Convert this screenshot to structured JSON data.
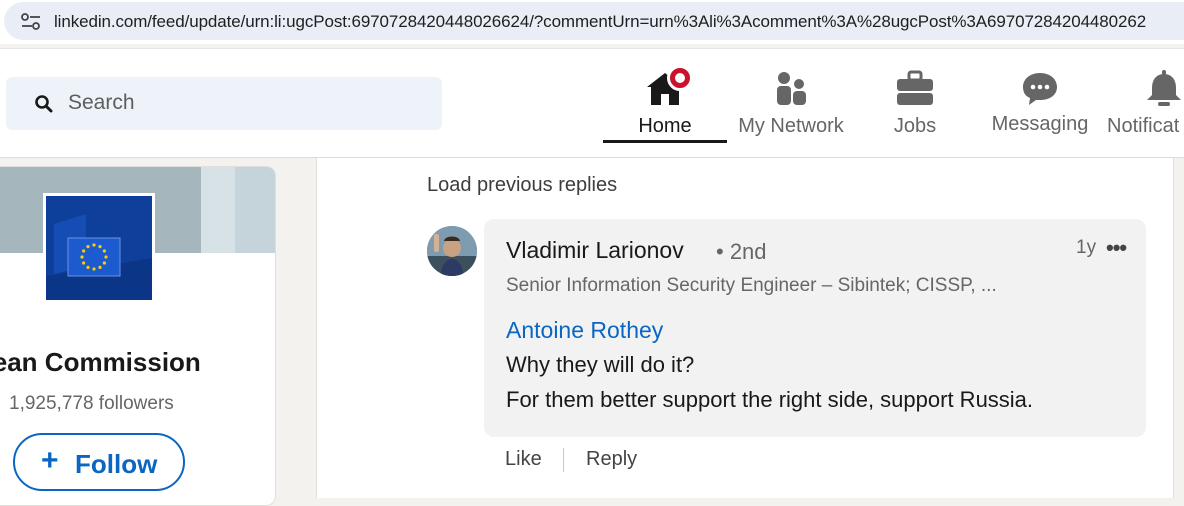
{
  "browser": {
    "url": "linkedin.com/feed/update/urn:li:ugcPost:6970728420448026624/?commentUrn=urn%3Ali%3Acomment%3A%28ugcPost%3A69707284204480262"
  },
  "header": {
    "search_placeholder": "Search",
    "nav": [
      {
        "label": "Home",
        "icon": "home-icon",
        "active": true
      },
      {
        "label": "My Network",
        "icon": "network-icon"
      },
      {
        "label": "Jobs",
        "icon": "briefcase-icon"
      },
      {
        "label": "Messaging",
        "icon": "messaging-icon"
      },
      {
        "label": "Notificat",
        "icon": "bell-icon"
      }
    ]
  },
  "sidebar": {
    "org_name": "opean Commission",
    "followers": "1,925,778 followers",
    "follow_label": "Follow",
    "follow_plus": "+"
  },
  "comments": {
    "load_previous": "Load previous replies",
    "reply": {
      "author": "Vladimir Larionov",
      "degree": "• 2nd",
      "time": "1y",
      "more": "•••",
      "headline": "Senior Information Security Engineer – Sibintek; CISSP, ...",
      "mention": "Antoine Rothey",
      "text_line1": "Why they will do it?",
      "text_line2": "For them better support the right side, support Russia."
    },
    "actions": {
      "like": "Like",
      "reply": "Reply"
    }
  },
  "colors": {
    "accent": "#0a66c2",
    "notification_badge": "#cb112d",
    "eu_blue": "#0e3f9b",
    "eu_gold": "#ffcc00"
  }
}
